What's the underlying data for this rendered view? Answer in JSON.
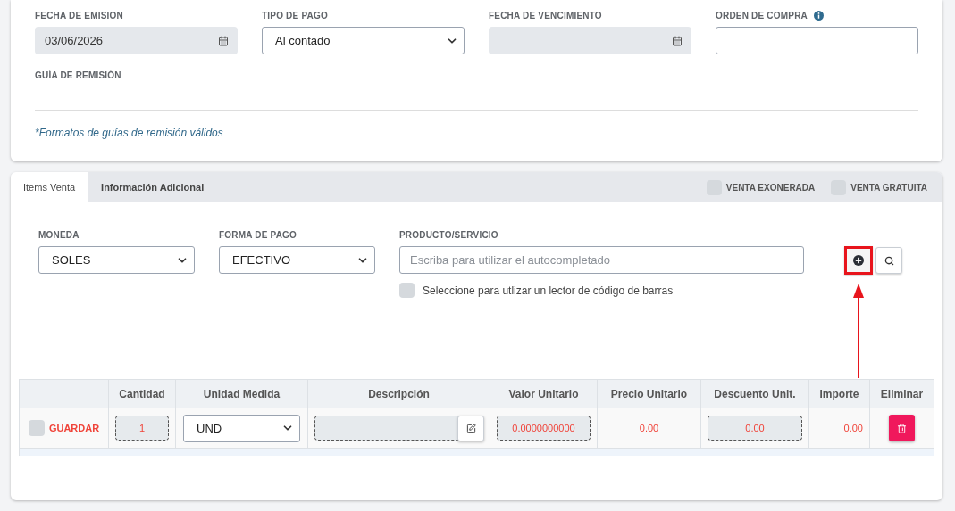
{
  "header_form": {
    "fields": [
      {
        "label": "FECHA DE EMISION",
        "kind": "date",
        "value": "03/06/2026"
      },
      {
        "label": "TIPO DE PAGO",
        "kind": "select",
        "value": "Al contado"
      },
      {
        "label": "FECHA DE VENCIMIENTO",
        "kind": "date"
      },
      {
        "label": "ORDEN DE COMPRA",
        "kind": "text",
        "info": true
      }
    ],
    "dispatch_guide_label": "GUÍA DE REMISIÓN",
    "note": "*Formatos de guías de remisión válidos"
  },
  "tabs": [
    {
      "label": "Items Venta",
      "selected": true
    },
    {
      "label": "Información Adicional",
      "selected": false
    }
  ],
  "sale_flags": [
    {
      "label": "VENTA EXONERADA",
      "checked": false
    },
    {
      "label": "VENTA GRATUITA",
      "checked": false
    }
  ],
  "currency": {
    "label": "MONEDA",
    "value": "SOLES"
  },
  "payment_method": {
    "label": "FORMA DE PAGO",
    "value": "EFECTIVO"
  },
  "product": {
    "label": "PRODUCTO/SERVICIO",
    "placeholder": "Escriba para utilizar el autocompletado",
    "add_highlighted": true,
    "barcode": {
      "label": "Seleccione para utlizar un lector de código de barras",
      "checked": false
    }
  },
  "annotation_arrow": true,
  "table": {
    "columns": [
      "Cantidad",
      "Unidad Medida",
      "Descripción",
      "Valor Unitario",
      "Precio Unitario",
      "Descuento Unit.",
      "Importe",
      "Eliminar"
    ],
    "rows": [
      {
        "checked": false,
        "save_label": "GUARDAR",
        "quantity": "1",
        "unit": "UND",
        "unit_value": "0.0000000000",
        "unit_price": "0.00",
        "discount": "0.00",
        "amount": "0.00"
      }
    ]
  }
}
